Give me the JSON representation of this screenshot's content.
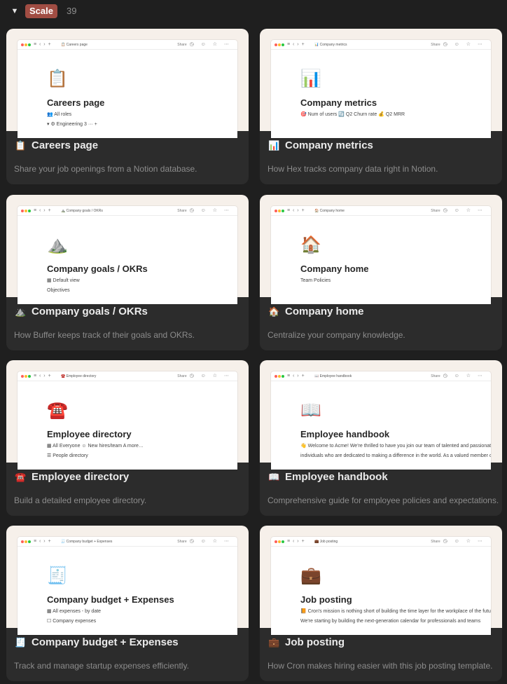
{
  "group": {
    "toggle_glyph": "▼",
    "name": "Scale",
    "count": "39"
  },
  "cards": [
    {
      "emoji": "📋",
      "title": "Careers page",
      "description": "Share your job openings from a Notion database.",
      "preview": {
        "tab": "📋 Careers page",
        "emoji": "📋",
        "title": "Careers page",
        "line1": "👥 All roles",
        "line2": "▾  ⚙ Engineering   3   ···  +"
      }
    },
    {
      "emoji": "📊",
      "title": "Company metrics",
      "description": "How Hex tracks company data right in Notion.",
      "preview": {
        "tab": "📊 Company metrics",
        "emoji": "📊",
        "title": "Company metrics",
        "line1": "🎯 Num of users          🔄 Q2 Churn rate          💰 Q2 MRR",
        "line2": ""
      }
    },
    {
      "emoji": "⛰️",
      "title": "Company goals / OKRs",
      "description": "How Buffer keeps track of their goals and OKRs.",
      "preview": {
        "tab": "⛰️ Company goals / OKRs",
        "emoji": "⛰️",
        "title": "Company goals / OKRs",
        "line1": "▦ Default view",
        "line2": "Objectives"
      }
    },
    {
      "emoji": "🏠",
      "title": "Company home",
      "description": "Centralize your company knowledge.",
      "preview": {
        "tab": "🏠 Company home",
        "emoji": "🏠",
        "title": "Company home",
        "line1": "Team                                  Policies",
        "line2": ""
      }
    },
    {
      "emoji": "☎️",
      "title": "Employee directory",
      "description": "Build a detailed employee directory.",
      "preview": {
        "tab": "☎️ Employee directory",
        "emoji": "☎️",
        "title": "Employee directory",
        "line1": "▦ All Everyone    ☺ New hires/team    A more…",
        "line2": "☰ People directory"
      }
    },
    {
      "emoji": "📖",
      "title": "Employee handbook",
      "description": "Comprehensive guide for employee policies and expectations.",
      "preview": {
        "tab": "📖 Employee handbook",
        "emoji": "📖",
        "title": "Employee handbook",
        "line1": "👋 Welcome to Acme! We're thrilled to have you join our team of talented and passionate",
        "line2": "individuals who are dedicated to making a difference in the world. As a valued member of"
      }
    },
    {
      "emoji": "🧾",
      "title": "Company budget + Expenses",
      "description": "Track and manage startup expenses efficiently.",
      "preview": {
        "tab": "🧾 Company budget + Expenses",
        "emoji": "🧾",
        "title": "Company budget + Expenses",
        "line1": "▦ All expenses - by date",
        "line2": "☐ Company expenses"
      }
    },
    {
      "emoji": "💼",
      "title": "Job posting",
      "description": "How Cron makes hiring easier with this job posting template.",
      "preview": {
        "tab": "💼 Job posting",
        "emoji": "💼",
        "title": "Job posting",
        "line1": "📙 Cron's mission is nothing short of building the time layer for the workplace of the future.",
        "line2": "We're starting by building the next-generation calendar for professionals and teams"
      }
    }
  ],
  "window_chrome": {
    "nav_icons": "≡ ‹ › +",
    "share_label": "Share",
    "right_icons": "◷ ☺ ☆ ⋯"
  },
  "colors": {
    "background": "#1f1f1f",
    "card": "#2c2c2c",
    "preview_bg": "#f6f0ea",
    "badge": "#a14d43"
  }
}
